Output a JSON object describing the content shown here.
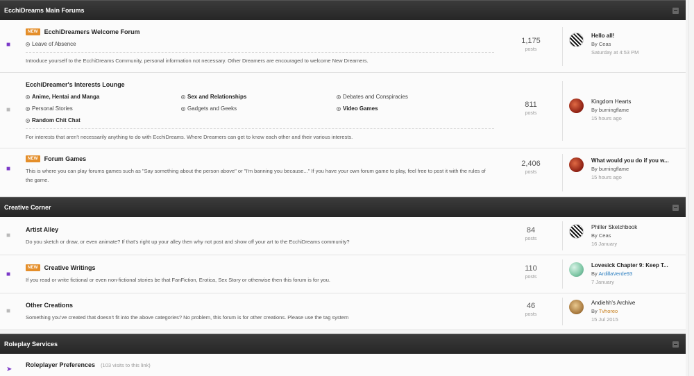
{
  "categories": [
    {
      "title": "EcchiDreams Main Forums",
      "forums": [
        {
          "badge": "NEW",
          "title": "EcchiDreamers Welcome Forum",
          "subforums": [
            {
              "label": "Leave of Absence",
              "bold": false
            }
          ],
          "description": "Introduce yourself to the EcchiDreams Community, personal information not necessary. Other Dreamers are encouraged to welcome New Dreamers.",
          "posts": "1,175",
          "posts_label": "posts",
          "last_title": "Hello all!",
          "last_by": "By",
          "last_user": "Ceas",
          "last_date": "Saturday at 4:53 PM"
        },
        {
          "badge": "",
          "title": "EcchiDreamer's Interests Lounge",
          "subforums": [
            {
              "label": "Anime, Hentai and Manga",
              "bold": true
            },
            {
              "label": "Sex and Relationships",
              "bold": true
            },
            {
              "label": "Debates and Conspiracies",
              "bold": false
            },
            {
              "label": "Personal Stories",
              "bold": false
            },
            {
              "label": "Gadgets and Geeks",
              "bold": false
            },
            {
              "label": "Video Games",
              "bold": true
            },
            {
              "label": "Random Chit Chat",
              "bold": true
            }
          ],
          "description": "For interests that aren't necessarily anything to do with EcchiDreams. Where Dreamers can get to know each other and their various interests.",
          "posts": "811",
          "posts_label": "posts",
          "last_title": "Kingdom Hearts",
          "last_by": "By",
          "last_user": "burningflame",
          "last_date": "15 hours ago"
        },
        {
          "badge": "NEW",
          "title": "Forum Games",
          "description": "This is where you can play forums games such as \"Say something about the person above\" or \"I'm banning you because...\" If you have your own forum game to play, feel free to post it with the rules of the game.",
          "posts": "2,406",
          "posts_label": "posts",
          "last_title": "What would you do if you w...",
          "last_by": "By",
          "last_user": "burningflame",
          "last_date": "15 hours ago"
        }
      ]
    },
    {
      "title": "Creative Corner",
      "forums": [
        {
          "badge": "",
          "title": "Artist Alley",
          "description": "Do you sketch or draw, or even animate? If that's right up your alley then why not post and show off your art to the EcchiDreams community?",
          "posts": "84",
          "posts_label": "posts",
          "last_title": "Philler Sketchbook",
          "last_by": "By",
          "last_user": "Ceas",
          "last_date": "16 January"
        },
        {
          "badge": "NEW",
          "title": "Creative Writings",
          "description": "If you read or write fictional or even non-fictional stories be that FanFiction, Erotica, Sex Story or otherwise then this forum is for you.",
          "posts": "110",
          "posts_label": "posts",
          "last_title": "Lovesick Chapter 9: Keep T...",
          "last_by": "By",
          "last_user": "ArdillaVerde93",
          "last_date": "7 January"
        },
        {
          "badge": "",
          "title": "Other Creations",
          "description": "Something you've created that doesn't fit into the above categories? No problem, this forum is for other creations. Please use the tag system",
          "posts": "46",
          "posts_label": "posts",
          "last_title": "Andiehh's Archive",
          "last_by": "By",
          "last_user": "Tvhoreo",
          "last_date": "15 Jul 2015"
        }
      ]
    },
    {
      "title": "Roleplay Services",
      "forums": [
        {
          "title": "Roleplayer Preferences",
          "visits": "(103 visits to this link)"
        }
      ]
    }
  ],
  "colors": {
    "badge": "#e48e2a",
    "unread_icon": "#7b38c8",
    "header_bg": "#2f2f2f",
    "user_blue": "#2a7dbf"
  }
}
